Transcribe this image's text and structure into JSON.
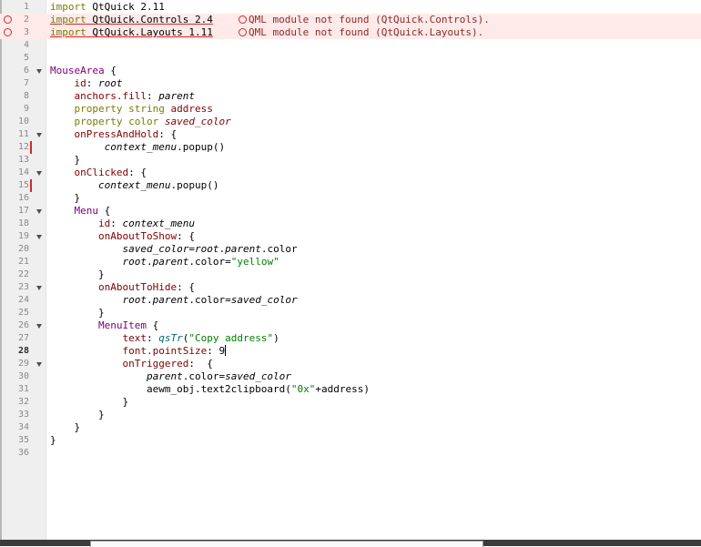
{
  "editor": {
    "current_line": 28,
    "lines": [
      {
        "num": "1",
        "text": "import QtQuick 2.11"
      },
      {
        "num": "2",
        "text": "import QtQuick.Controls 2.4"
      },
      {
        "num": "3",
        "text": "import QtQuick.Layouts 1.11"
      },
      {
        "num": "4",
        "text": ""
      },
      {
        "num": "5",
        "text": ""
      },
      {
        "num": "6",
        "text": "MouseArea {"
      },
      {
        "num": "7",
        "text": "    id: root"
      },
      {
        "num": "8",
        "text": "    anchors.fill: parent"
      },
      {
        "num": "9",
        "text": "    property string address"
      },
      {
        "num": "10",
        "text": "    property color saved_color"
      },
      {
        "num": "11",
        "text": "    onPressAndHold: {"
      },
      {
        "num": "12",
        "text": "         context_menu.popup()"
      },
      {
        "num": "13",
        "text": "    }"
      },
      {
        "num": "14",
        "text": "    onClicked: {"
      },
      {
        "num": "15",
        "text": "        context_menu.popup()"
      },
      {
        "num": "16",
        "text": "    }"
      },
      {
        "num": "17",
        "text": "    Menu {"
      },
      {
        "num": "18",
        "text": "        id: context_menu"
      },
      {
        "num": "19",
        "text": "        onAboutToShow: {"
      },
      {
        "num": "20",
        "text": "            saved_color=root.parent.color"
      },
      {
        "num": "21",
        "text": "            root.parent.color=\"yellow\""
      },
      {
        "num": "22",
        "text": "        }"
      },
      {
        "num": "23",
        "text": "        onAboutToHide: {"
      },
      {
        "num": "24",
        "text": "            root.parent.color=saved_color"
      },
      {
        "num": "25",
        "text": "        }"
      },
      {
        "num": "26",
        "text": "        MenuItem {"
      },
      {
        "num": "27",
        "text": "            text: qsTr(\"Copy address\")"
      },
      {
        "num": "28",
        "text": "            font.pointSize: 9"
      },
      {
        "num": "29",
        "text": "            onTriggered:  {"
      },
      {
        "num": "30",
        "text": "                parent.color=saved_color"
      },
      {
        "num": "31",
        "text": "                aewm_obj.text2clipboard(\"0x\"+address)"
      },
      {
        "num": "32",
        "text": "            }"
      },
      {
        "num": "33",
        "text": "        }"
      },
      {
        "num": "34",
        "text": "    }"
      },
      {
        "num": "35",
        "text": "}"
      },
      {
        "num": "36",
        "text": ""
      }
    ],
    "warnings": {
      "line2": "QML module not found (QtQuick.Controls).",
      "line3": "QML module not found (QtQuick.Layouts)."
    }
  }
}
